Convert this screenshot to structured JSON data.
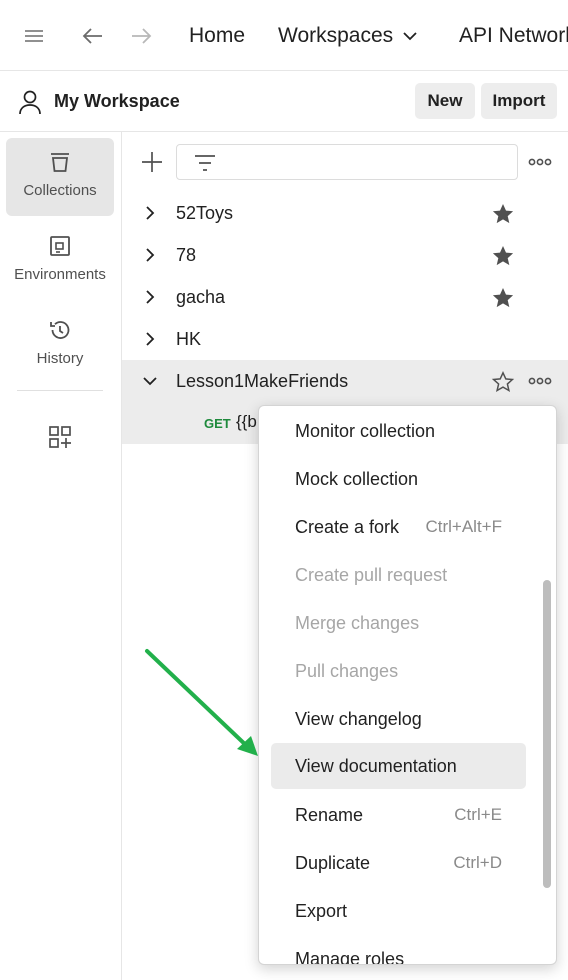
{
  "topbar": {
    "menu_icon": "hamburger-icon",
    "back_icon": "arrow-left-icon",
    "forward_icon": "arrow-right-icon",
    "home": "Home",
    "workspaces": "Workspaces",
    "api_network": "API Network"
  },
  "workspace": {
    "title": "My Workspace",
    "new_label": "New",
    "import_label": "Import"
  },
  "rail": {
    "items": [
      {
        "label": "Collections",
        "icon": "collections-icon",
        "active": true
      },
      {
        "label": "Environments",
        "icon": "environments-icon"
      },
      {
        "label": "History",
        "icon": "history-icon"
      }
    ],
    "add_icon": "add-apps-icon"
  },
  "collections": [
    {
      "name": "52Toys",
      "starred": true
    },
    {
      "name": "78",
      "starred": true
    },
    {
      "name": "gacha",
      "starred": true
    },
    {
      "name": "HK",
      "starred": false
    },
    {
      "name": "Lesson1MakeFriends",
      "starred": false,
      "expanded": true
    }
  ],
  "request": {
    "method": "GET",
    "name": "{{b"
  },
  "menu": {
    "items": [
      {
        "label": "Monitor collection"
      },
      {
        "label": "Mock collection"
      },
      {
        "label": "Create a fork",
        "shortcut": "Ctrl+Alt+F"
      },
      {
        "label": "Create pull request",
        "disabled": true
      },
      {
        "label": "Merge changes",
        "disabled": true
      },
      {
        "label": "Pull changes",
        "disabled": true
      },
      {
        "label": "View changelog"
      },
      {
        "label": "View documentation",
        "hover": true
      },
      {
        "label": "Rename",
        "shortcut": "Ctrl+E"
      },
      {
        "label": "Duplicate",
        "shortcut": "Ctrl+D"
      },
      {
        "label": "Export"
      },
      {
        "label": "Manage roles"
      }
    ]
  },
  "colors": {
    "accent_arrow": "#22b04b",
    "get_method": "#1e8a3c"
  }
}
